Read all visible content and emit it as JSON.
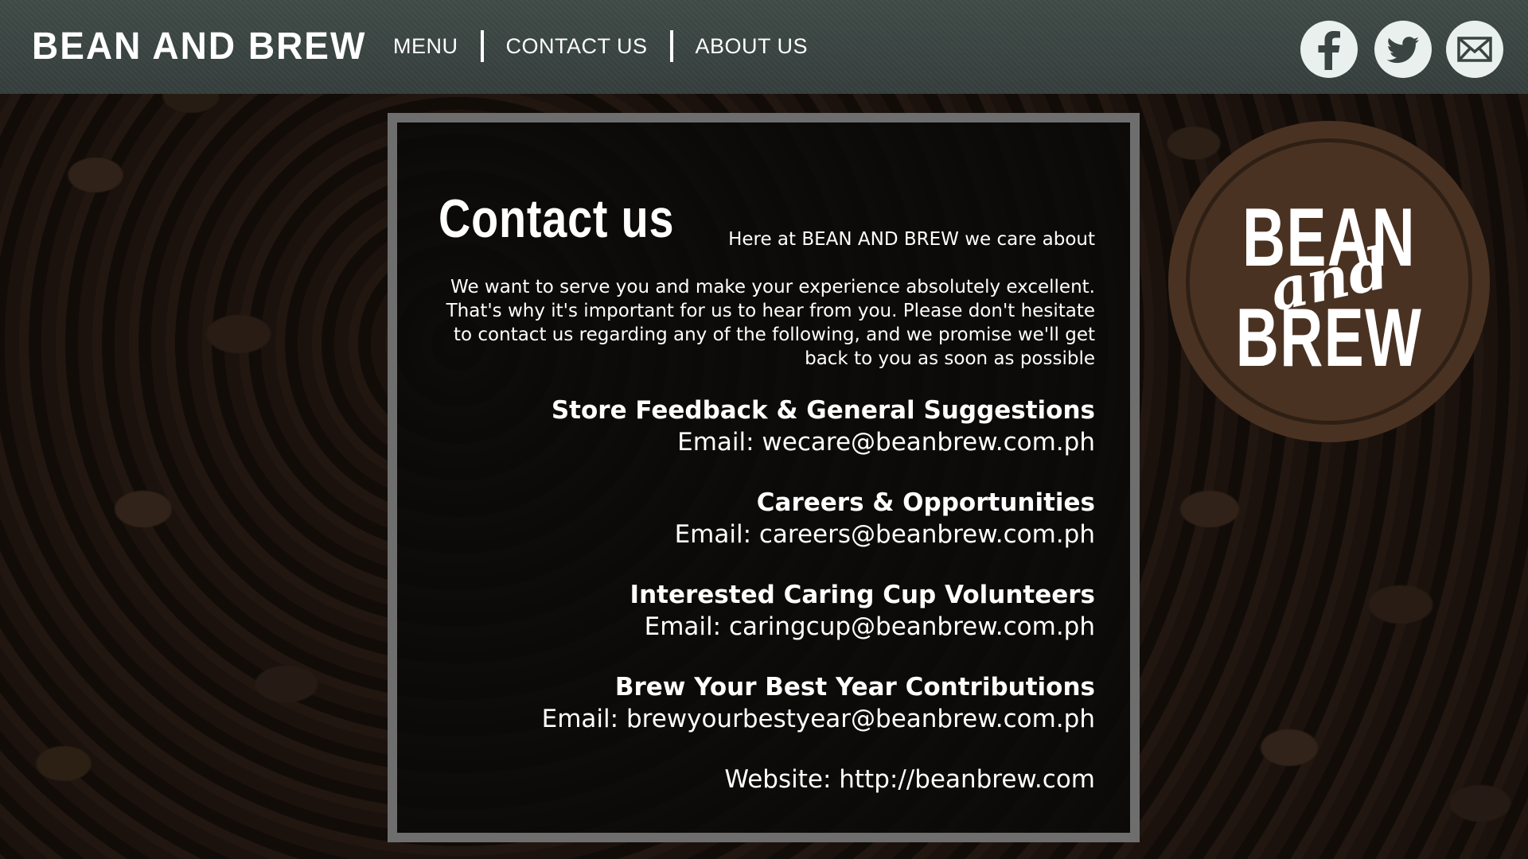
{
  "header": {
    "brand": "BEAN AND BREW",
    "nav": [
      {
        "label": "MENU"
      },
      {
        "label": "CONTACT US"
      },
      {
        "label": "ABOUT US"
      }
    ],
    "social_icons": [
      "facebook-icon",
      "twitter-icon",
      "mail-icon"
    ]
  },
  "contact": {
    "title": "Contact us",
    "intro_lead": "Here at BEAN AND BREW we care about",
    "intro": "We want to serve you and make your experience absolutely excellent. That's why it's important for us to hear from you. Please don't hesitate to contact us regarding any of the following, and we promise we'll get back to you as soon as possible",
    "sections": [
      {
        "title": "Store Feedback & General Suggestions",
        "email": "Email: wecare@beanbrew.com.ph"
      },
      {
        "title": "Careers & Opportunities",
        "email": "Email: careers@beanbrew.com.ph"
      },
      {
        "title": "Interested Caring Cup Volunteers",
        "email": "Email: caringcup@beanbrew.com.ph"
      },
      {
        "title": "Brew Your Best Year Contributions",
        "email": "Email: brewyourbestyear@beanbrew.com.ph"
      }
    ],
    "website": "Website: http://beanbrew.com"
  },
  "logo": {
    "line1": "BEAN",
    "line2": "and",
    "line3": "BREW"
  },
  "colors": {
    "header_bg": "#3a4442",
    "panel_border": "#6e6e6e",
    "logo_bg": "#4a3222",
    "icon_bg": "#eaf0ee"
  }
}
